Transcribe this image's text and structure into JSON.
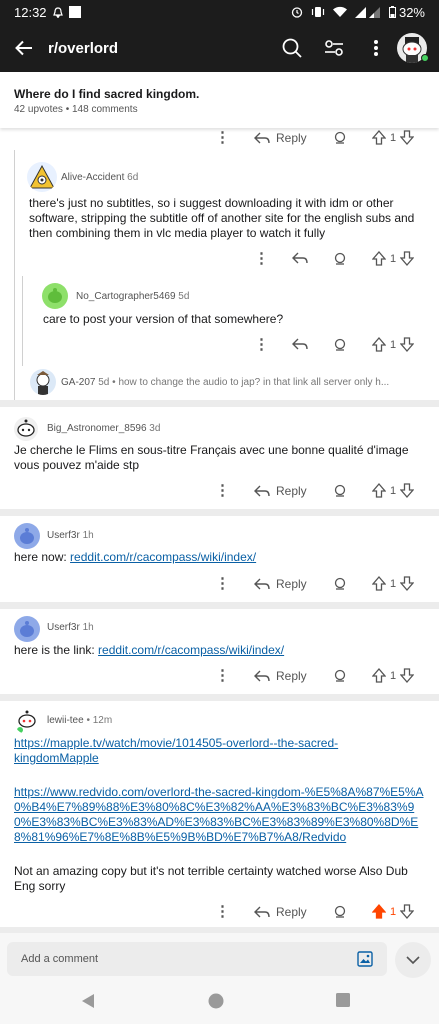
{
  "status_bar": {
    "time": "12:32",
    "battery": "32%"
  },
  "app_bar": {
    "title": "r/overlord"
  },
  "post": {
    "title": "Where do I find sacred kingdom.",
    "upvotes": "42 upvotes",
    "comments": "148 comments"
  },
  "labels": {
    "reply": "Reply"
  },
  "comments": [
    {
      "user": "Alive-Accident",
      "time": "6d",
      "body": "there's just no subtitles, so i suggest downloading it with idm or other software, stripping the subtitle off of another site for the english subs and then combining them in vlc media player to watch it fully",
      "votes": "1"
    },
    {
      "user": "No_Cartographer5469",
      "time": "5d",
      "body": "care to post your version of that somewhere?",
      "votes": "1"
    },
    {
      "user": "GA-207",
      "time": "5d",
      "preview": "how to change the audio to jap? in that link all server only h..."
    },
    {
      "user": "Big_Astronomer_8596",
      "time": "3d",
      "body": "Je cherche le Flims en sous-titre Français avec une bonne qualité d'image vous pouvez m'aide stp",
      "votes": "1"
    },
    {
      "user": "Userf3r",
      "time": "1h",
      "body_prefix": "here now: ",
      "link": "reddit.com/r/cacompass/wiki/index/",
      "votes": "1"
    },
    {
      "user": "Userf3r",
      "time": "1h",
      "body_prefix": "here is the link: ",
      "link": "reddit.com/r/cacompass/wiki/index/",
      "votes": "1"
    },
    {
      "user": "lewii-tee",
      "time": "12m",
      "link1": "https://mapple.tv/watch/movie/1014505-overlord--the-sacred-kingdomMapple",
      "link2": "https://www.redvido.com/overlord-the-sacred-kingdom-%E5%8A%87%E5%A0%B4%E7%89%88%E3%80%8C%E3%82%AA%E3%83%BC%E3%83%90%E3%83%BC%E3%83%AD%E3%83%BC%E3%83%89%E3%80%8D%E8%81%96%E7%8E%8B%E5%9B%BD%E7%B7%A8/Redvido",
      "body": "Not an amazing copy but it's not terrible certainty watched worse Also Dub Eng sorry",
      "votes": "1"
    }
  ],
  "composer": {
    "placeholder": "Add a comment"
  },
  "colors": {
    "appbar": "#1c1c1c",
    "link": "#0a60a5",
    "upvoted": "#ff4500"
  }
}
